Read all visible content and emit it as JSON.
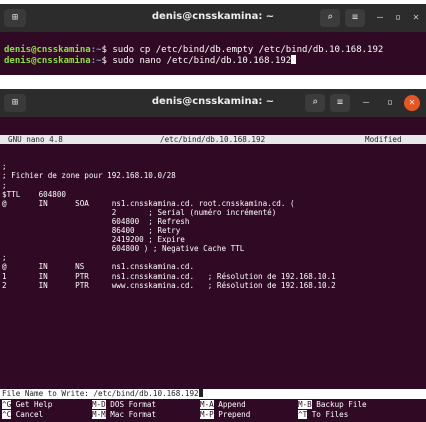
{
  "window1": {
    "title": "denis@cnsskamina: ~",
    "lines": [
      {
        "user": "denis@cnsskamina",
        "path": ":~",
        "cmd": "$ sudo cp /etc/bind/db.empty /etc/bind/db.10.168.192"
      },
      {
        "user": "denis@cnsskamina",
        "path": ":~",
        "cmd": "$ sudo nano /etc/bind/db.10.168.192"
      }
    ]
  },
  "window2": {
    "title": "denis@cnsskamina: ~",
    "nano": {
      "version": "GNU nano 4.8",
      "file": "/etc/bind/db.10.168.192",
      "status": "Modified",
      "lines": [
        ";",
        "; Fichier de zone pour 192.168.10.0/28",
        ";",
        "$TTL    604800",
        "@       IN      SOA     ns1.cnsskamina.cd. root.cnsskamina.cd. (",
        "                        2       ; Serial (numéro incrémenté)",
        "                        604800  ; Refresh",
        "                        86400   ; Retry",
        "                        2419200 ; Expire",
        "                        604800 ) ; Negative Cache TTL",
        ";",
        "@       IN      NS      ns1.cnsskamina.cd.",
        "1       IN      PTR     ns1.cnsskamina.cd.   ; Résolution de 192.168.10.1",
        "2       IN      PTR     www.cnsskamina.cd.   ; Résolution de 192.168.10.2"
      ],
      "prompt_label": "File Name to Write: ",
      "prompt_value": "/etc/bind/db.10.168.192",
      "shortcuts_row1": [
        {
          "key": "^G",
          "label": "Get Help"
        },
        {
          "key": "M-D",
          "label": "DOS Format"
        },
        {
          "key": "M-A",
          "label": "Append"
        },
        {
          "key": "M-B",
          "label": "Backup File"
        }
      ],
      "shortcuts_row2": [
        {
          "key": "^C",
          "label": "Cancel"
        },
        {
          "key": "M-M",
          "label": "Mac Format"
        },
        {
          "key": "M-P",
          "label": "Prepend"
        },
        {
          "key": "^T",
          "label": "To Files"
        }
      ]
    }
  }
}
